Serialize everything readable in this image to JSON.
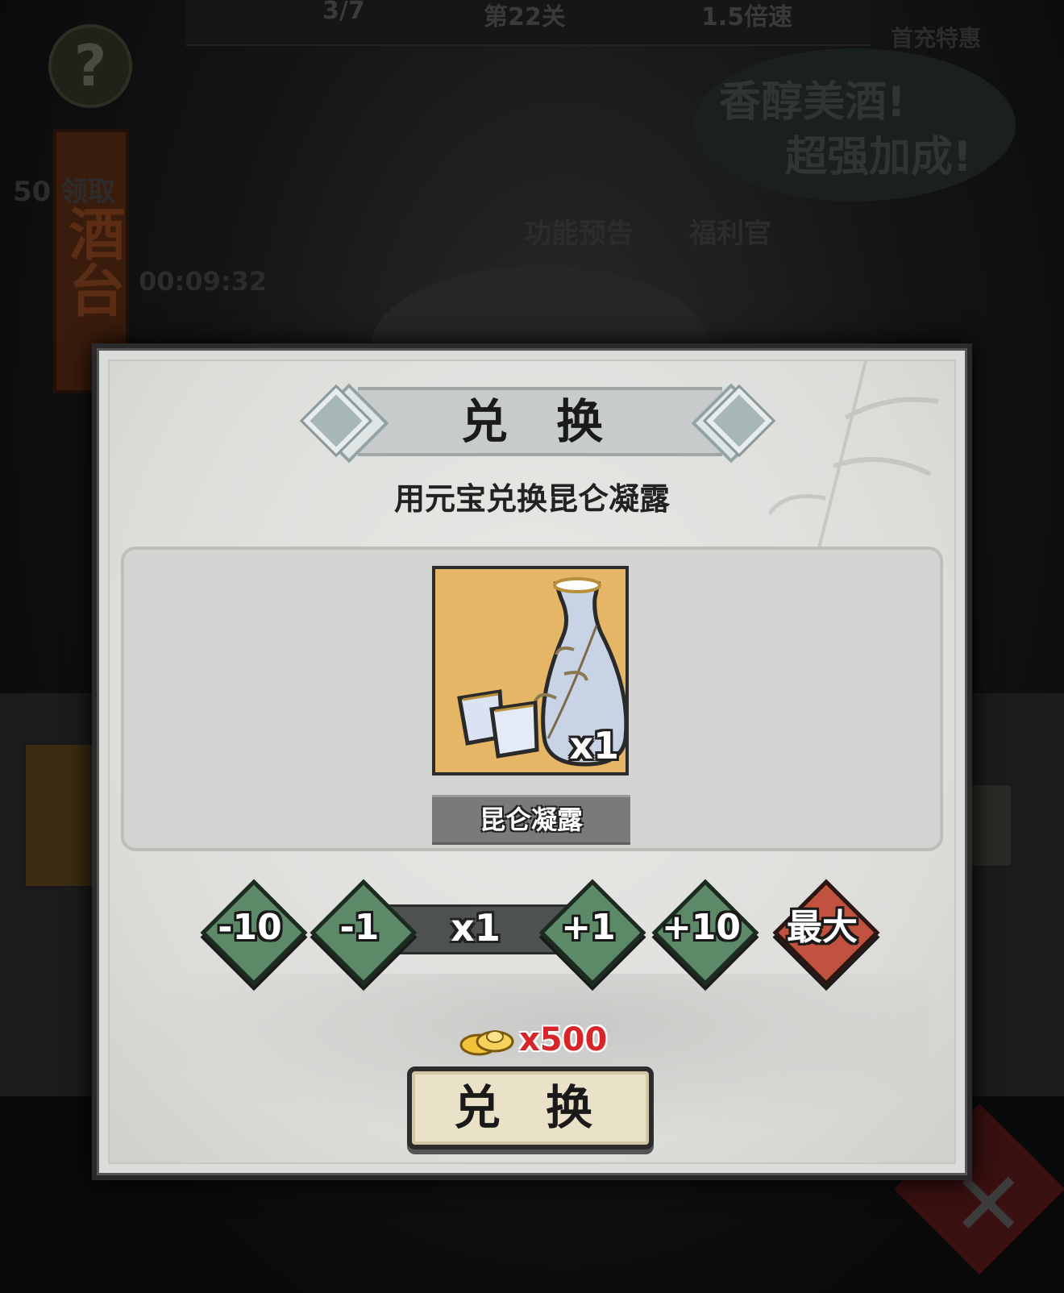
{
  "background": {
    "topbar": {
      "progress": "3/7",
      "stage": "第22关",
      "speed": "1.5倍速"
    },
    "help_glyph": "?",
    "banner_text": "酒台",
    "claim_text": "50 领取",
    "timer": "00:09:32",
    "promo_bubble": {
      "line1": "香醇美酒!",
      "line2": "超强加成!"
    },
    "first_recharge": "首充特惠",
    "feature_preview": "功能预告",
    "welfare": "福利官",
    "close_glyph": "✕"
  },
  "dialog": {
    "title": "兑 换",
    "subtitle": "用元宝兑换昆仑凝露",
    "item": {
      "name": "昆仑凝露",
      "quantity_badge": "x1",
      "icon": "wine-bottle-icon",
      "frame_color": "#e6b667"
    },
    "stepper": {
      "minus10": "-10",
      "minus1": "-1",
      "value": "x1",
      "plus1": "+1",
      "plus10": "+10",
      "max": "最大"
    },
    "cost": {
      "currency_icon": "gold-ingot-icon",
      "amount": "x500",
      "color": "#d7252a"
    },
    "exchange_button": "兑 换"
  }
}
